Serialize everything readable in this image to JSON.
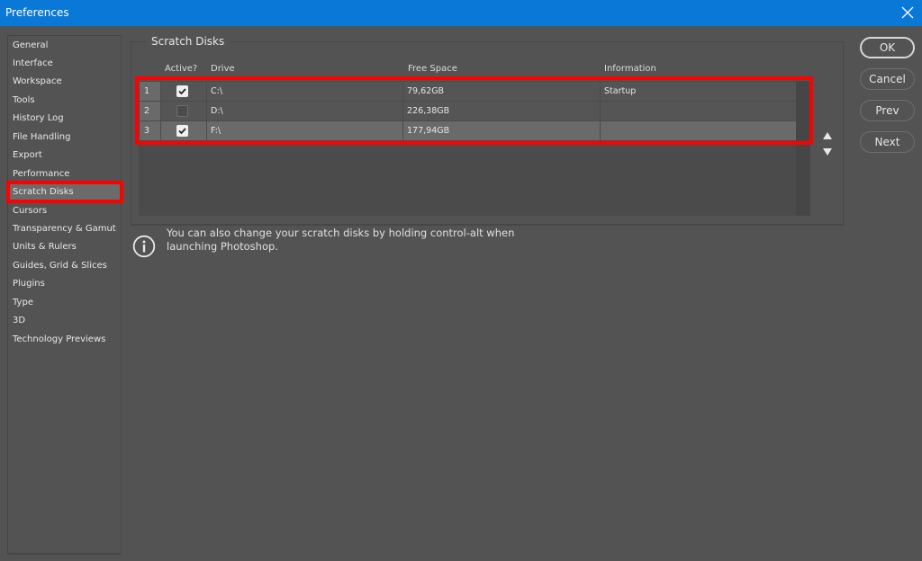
{
  "window": {
    "title": "Preferences",
    "close_icon": "close-icon"
  },
  "sidebar": {
    "selected": "Scratch Disks",
    "items": [
      {
        "label": "General"
      },
      {
        "label": "Interface"
      },
      {
        "label": "Workspace"
      },
      {
        "label": "Tools"
      },
      {
        "label": "History Log"
      },
      {
        "label": "File Handling"
      },
      {
        "label": "Export"
      },
      {
        "label": "Performance"
      },
      {
        "label": "Scratch Disks"
      },
      {
        "label": "Cursors"
      },
      {
        "label": "Transparency & Gamut"
      },
      {
        "label": "Units & Rulers"
      },
      {
        "label": "Guides, Grid & Slices"
      },
      {
        "label": "Plugins"
      },
      {
        "label": "Type"
      },
      {
        "label": "3D"
      },
      {
        "label": "Technology Previews"
      }
    ]
  },
  "scratch_disks": {
    "section_title": "Scratch Disks",
    "columns": {
      "active": "Active?",
      "drive": "Drive",
      "free_space": "Free Space",
      "information": "Information"
    },
    "rows": [
      {
        "num": "1",
        "active": true,
        "drive": "C:\\",
        "free_space": "79,62GB",
        "information": "Startup"
      },
      {
        "num": "2",
        "active": false,
        "drive": "D:\\",
        "free_space": "226,38GB",
        "information": ""
      },
      {
        "num": "3",
        "active": true,
        "drive": "F:\\",
        "free_space": "177,94GB",
        "information": ""
      }
    ],
    "selected_row": 3,
    "move_up_icon": "triangle-up-icon",
    "move_down_icon": "triangle-down-icon"
  },
  "info": {
    "icon": "info-icon",
    "text": "You can also change your scratch disks by holding control-alt when launching Photoshop."
  },
  "buttons": {
    "ok": "OK",
    "cancel": "Cancel",
    "prev": "Prev",
    "next": "Next"
  },
  "colors": {
    "titlebar": "#0a78d7",
    "background": "#535353",
    "annotation_red": "#ff0000"
  }
}
